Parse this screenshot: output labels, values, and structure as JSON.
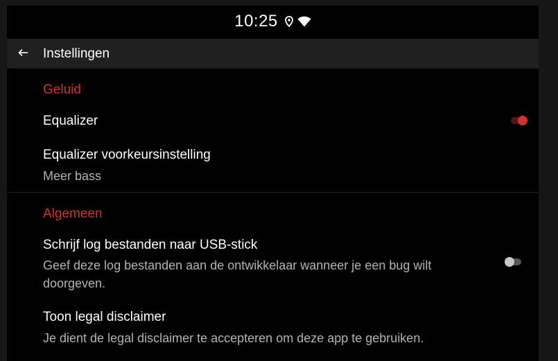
{
  "status_bar": {
    "time": "10:25",
    "icons": [
      "location-icon",
      "wifi-icon"
    ]
  },
  "app_bar": {
    "back_icon": "back-arrow-icon",
    "title": "Instellingen"
  },
  "categories": {
    "sound": {
      "title": "Geluid",
      "items": {
        "equalizer": {
          "title": "Equalizer",
          "enabled": true
        },
        "preset": {
          "title": "Equalizer voorkeursinstelling",
          "summary": "Meer bass"
        }
      }
    },
    "general": {
      "title": "Algemeen",
      "items": {
        "log": {
          "title": "Schrijf log bestanden naar USB-stick",
          "summary": "Geef deze log bestanden aan de ontwikkelaar wanneer je een bug wilt doorgeven.",
          "enabled": false
        },
        "disclaimer": {
          "title": "Toon legal disclaimer",
          "summary": "Je dient de legal disclaimer te accepteren om deze app te gebruiken."
        }
      }
    }
  },
  "colors": {
    "accent": "#d2322d",
    "switch_on_track": "#5a1512",
    "switch_off_thumb": "#c8c8c8",
    "switch_off_track": "#555555",
    "background": "#000000",
    "app_bar": "#202020"
  }
}
